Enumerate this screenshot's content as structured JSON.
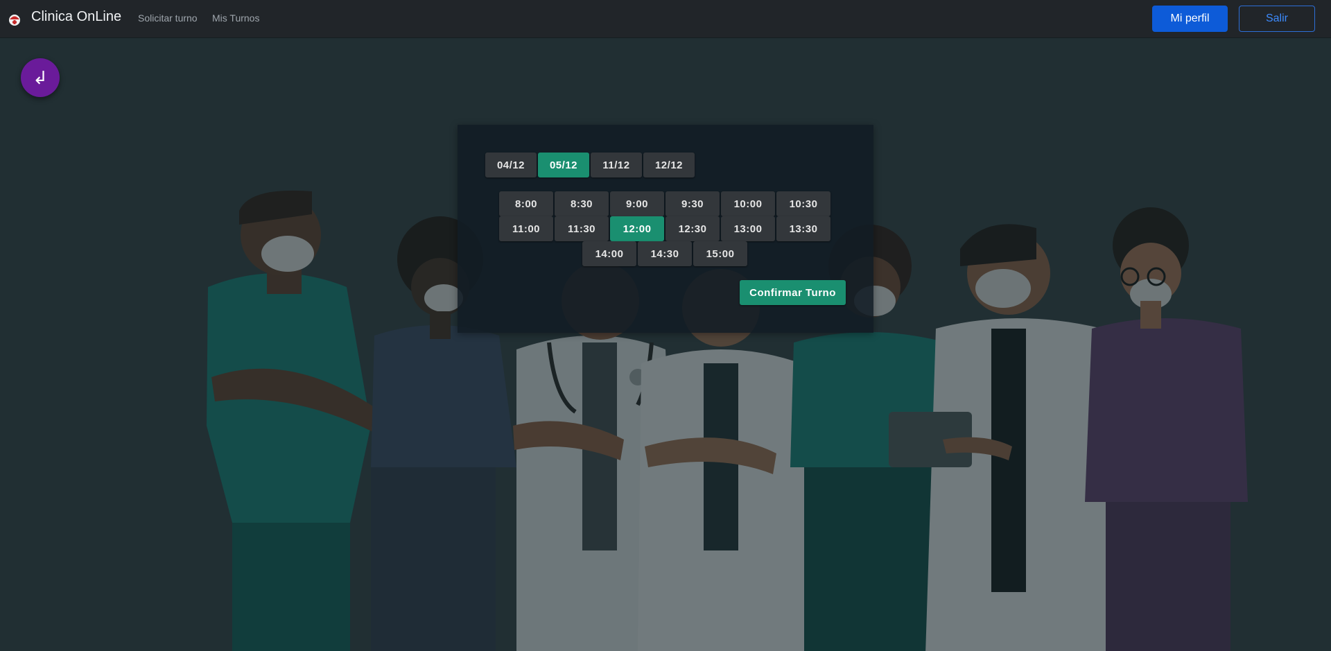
{
  "navbar": {
    "brand_title": "Clinica OnLine",
    "links": [
      "Solicitar turno",
      "Mis Turnos"
    ],
    "profile_button": "Mi perfil",
    "logout_button": "Salir"
  },
  "back_button": {
    "icon": "return-arrow-icon",
    "glyph": "↲"
  },
  "booking": {
    "dates": [
      "04/12",
      "05/12",
      "11/12",
      "12/12"
    ],
    "selected_date": "05/12",
    "times": [
      "8:00",
      "8:30",
      "9:00",
      "9:30",
      "10:00",
      "10:30",
      "11:00",
      "11:30",
      "12:00",
      "12:30",
      "13:00",
      "13:30",
      "14:00",
      "14:30",
      "15:00"
    ],
    "selected_time": "12:00",
    "confirm_label": "Confirmar Turno"
  },
  "colors": {
    "navbar_bg": "#212529",
    "primary": "#0d5bd8",
    "accent_green": "#1a8f70",
    "back_button_purple": "#6a1b9a",
    "chip_bg": "#33373b"
  }
}
